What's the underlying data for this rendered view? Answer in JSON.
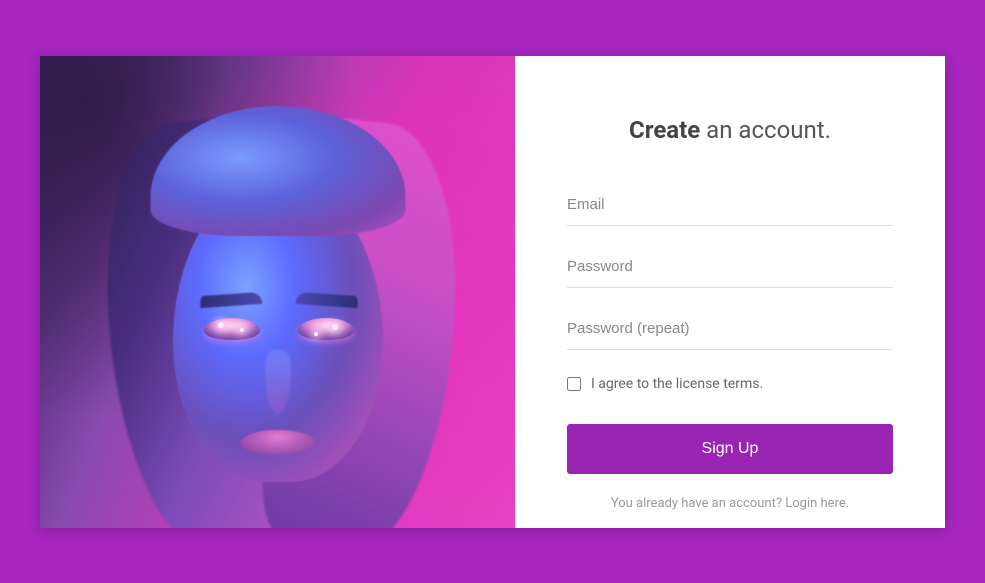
{
  "heading": {
    "bold": "Create",
    "rest": " an account."
  },
  "fields": {
    "email_placeholder": "Email",
    "password_placeholder": "Password",
    "password_repeat_placeholder": "Password (repeat)"
  },
  "terms_label": "I agree to the license terms.",
  "signup_label": "Sign Up",
  "login_link": "You already have an account? Login here."
}
